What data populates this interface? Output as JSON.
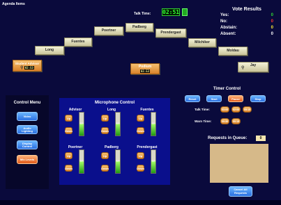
{
  "header": {
    "agenda": "Agenda Items",
    "talk_time_label": "Talk Time:",
    "talk_time_value": "02:51"
  },
  "votes": {
    "title": "Vote Results",
    "rows": [
      {
        "label": "Yes:",
        "value": "0",
        "color": "#33dd33"
      },
      {
        "label": "No:",
        "value": "0",
        "color": "#ff3333"
      },
      {
        "label": "Abstain:",
        "value": "0",
        "color": "#ffee33"
      },
      {
        "label": "Absent:",
        "value": "0",
        "color": "#ffffff"
      }
    ]
  },
  "seats": {
    "padberg": "Padberg",
    "poertner": "Poertner",
    "prendergast": "Prendergast",
    "fuentes": "Fuentes",
    "milchiker": "Milchiker",
    "long": "Long",
    "moldau": "Moldau",
    "student_adviser": "Student Advisor",
    "student_timer": "02:53",
    "podium": "Podium",
    "podium_timer": "02:53",
    "jay": "Jay"
  },
  "control_menu": {
    "title": "Control Menu",
    "items": [
      "Video",
      "Audio Lighting",
      "Display Control",
      "Mic Levels"
    ]
  },
  "microphone_control": {
    "title": "Microphone Control",
    "up_label": "Up",
    "down_label": "Down",
    "mics": [
      {
        "name": "Advisor",
        "level": 53
      },
      {
        "name": "Long",
        "level": 53
      },
      {
        "name": "Fuentes",
        "level": 53
      },
      {
        "name": "Poertner",
        "level": 53
      },
      {
        "name": "Padberg",
        "level": 53
      },
      {
        "name": "Prendergast",
        "level": 53
      }
    ]
  },
  "timer_control": {
    "title": "Timer Control",
    "buttons": [
      "Reset",
      "Start",
      "Pause",
      "Stop"
    ],
    "talk_time_label": "Talk Time:",
    "talk_times": [
      "03:00",
      "02:00",
      "05:15"
    ],
    "warn_time_label": "Warn Time:",
    "warn_times": [
      "00:30",
      "00:15"
    ]
  },
  "requests": {
    "label": "Requests in Queue:",
    "count": "0",
    "cancel_label": "Cancel All Requests"
  }
}
